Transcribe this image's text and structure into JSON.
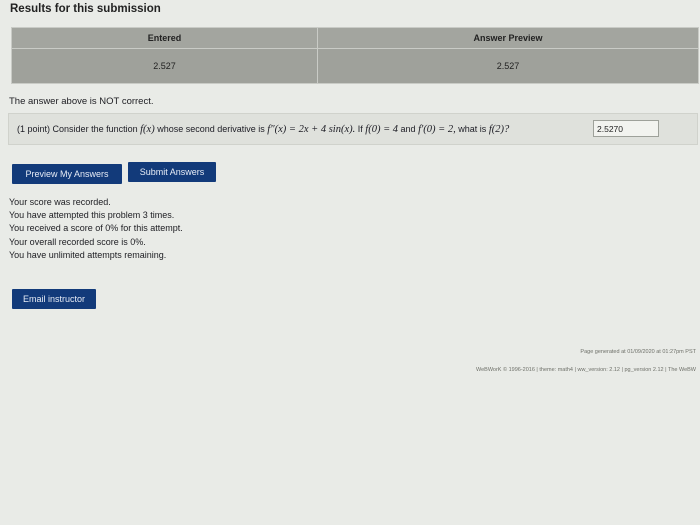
{
  "results": {
    "title": "Results for this submission",
    "headers": {
      "entered": "Entered",
      "preview": "Answer Preview"
    },
    "row": {
      "entered": "2.527",
      "preview": "2.527"
    }
  },
  "feedback": "The answer above is NOT correct.",
  "problem": {
    "points": "(1 point)",
    "consider": "Consider the function",
    "fx": "f(x)",
    "whose": "whose second derivative is",
    "fpp": "f″(x) = 2x + 4 sin(x).",
    "if": "If",
    "f0": "f(0) = 4",
    "and": "and",
    "fp0": "f′(0) = 2,",
    "what": "what is",
    "f2": "f(2)?",
    "answer_value": "2.5270"
  },
  "buttons": {
    "preview": "Preview My Answers",
    "submit": "Submit Answers",
    "email": "Email instructor"
  },
  "score": [
    "Your score was recorded.",
    "You have attempted this problem 3 times.",
    "You received a score of 0% for this attempt.",
    "Your overall recorded score is 0%.",
    "You have unlimited attempts remaining."
  ],
  "footer": {
    "generated": "Page generated at 01/09/2020 at 01:27pm PST",
    "credits": "WeBWorK © 1996-2016 | theme: math4 | ww_version: 2.12 | pg_version 2.12 | The WeBW"
  },
  "colors": {
    "button_bg": "#123a7a",
    "table_bg": "#9fa19b",
    "page_bg": "#e9ebe7"
  }
}
